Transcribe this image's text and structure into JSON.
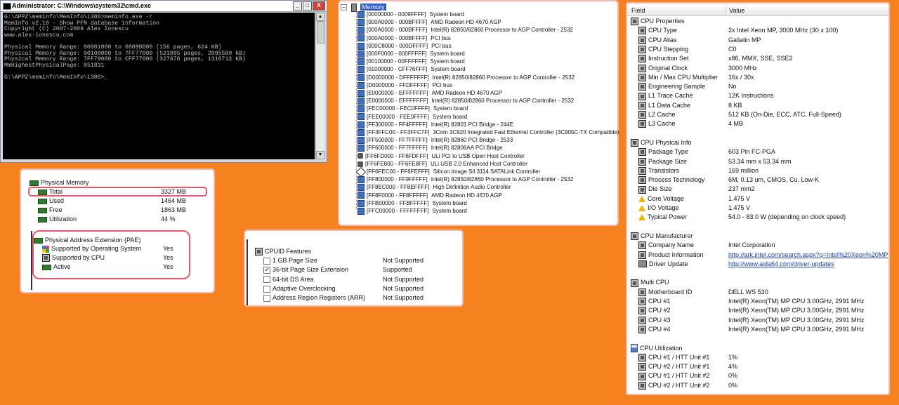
{
  "cmd": {
    "title": "Administrator: C:\\Windows\\system32\\cmd.exe",
    "btn_min": "_",
    "btn_max": "□",
    "btn_close": "X",
    "lines": [
      "G:\\APPZ\\meminfo\\MemInfo\\i386>meminfo.exe -r",
      "MemInfo v2.10 - Show PFN database information",
      "Copyright (C) 2007-2009 Alex Ionescu",
      "www.alex-ionescu.com",
      "",
      "Physical Memory Range: 00001000 to 0009D000 (156 pages, 624 KB)",
      "Physical Memory Range: 00100000 to 7FF77000 (523895 pages, 2095580 KB)",
      "Physical Memory Range: 7FF79000 to CFF77000 (327678 pages, 1310712 KB)",
      "MmHighestPhysicalPage: 851831",
      "",
      "G:\\APPZ\\meminfo\\MemInfo\\i386>_"
    ]
  },
  "memory_panel": {
    "header": "Physical Memory",
    "items": [
      {
        "label": "Total",
        "value": "3327 MB"
      },
      {
        "label": "Used",
        "value": "1464 MB"
      },
      {
        "label": "Free",
        "value": "1863 MB"
      },
      {
        "label": "Utilization",
        "value": "44 %"
      }
    ],
    "pae_header": "Physical Address Extension (PAE)",
    "pae_items": [
      {
        "label": "Supported by Operating System",
        "value": "Yes"
      },
      {
        "label": "Supported by CPU",
        "value": "Yes"
      },
      {
        "label": "Active",
        "value": "Yes"
      }
    ]
  },
  "cpuid_panel": {
    "header": "CPUID Features",
    "items": [
      {
        "label": "1 GB Page Size",
        "value": "Not Supported",
        "checked": false
      },
      {
        "label": "36-bit Page Size Extension",
        "value": "Supported",
        "checked": true
      },
      {
        "label": "64-bit DS Area",
        "value": "Not Supported",
        "checked": false
      },
      {
        "label": "Adaptive Overclocking",
        "value": "Not Supported",
        "checked": false
      },
      {
        "label": "Address Region Registers (ARR)",
        "value": "Not Supported",
        "checked": false
      }
    ]
  },
  "memtree": {
    "root": "Memory",
    "expander": "−",
    "items": [
      {
        "range": "[00000000 - 0009FFFF]",
        "desc": "System board",
        "icon": "monitor"
      },
      {
        "range": "[000A0000 - 000BFFFF]",
        "desc": "AMD Radeon HD 4670 AGP",
        "icon": "monitor"
      },
      {
        "range": "[000A0000 - 000BFFFF]",
        "desc": "Intel(R) 82850/82860 Processor to AGP Controller - 2532",
        "icon": "monitor"
      },
      {
        "range": "[000A0000 - 000BFFFF]",
        "desc": "PCI bus",
        "icon": "monitor"
      },
      {
        "range": "[000C8000 - 000DFFFF]",
        "desc": "PCI bus",
        "icon": "monitor"
      },
      {
        "range": "[000F0000 - 000FFFFF]",
        "desc": "System board",
        "icon": "monitor"
      },
      {
        "range": "[00100000 - 00FFFFFF]",
        "desc": "System board",
        "icon": "monitor"
      },
      {
        "range": "[01000000 - CFF76FFF]",
        "desc": "System board",
        "icon": "monitor"
      },
      {
        "range": "[D0000000 - DFFFFFFF]",
        "desc": "Intel(R) 82850/82860 Processor to AGP Controller - 2532",
        "icon": "monitor"
      },
      {
        "range": "[D0000000 - FFDFFFFF]",
        "desc": "PCI bus",
        "icon": "monitor"
      },
      {
        "range": "[E0000000 - EFFFFFFF]",
        "desc": "AMD Radeon HD 4670 AGP",
        "icon": "monitor"
      },
      {
        "range": "[E0000000 - EFFFFFFF]",
        "desc": "Intel(R) 82850/82860 Processor to AGP Controller - 2532",
        "icon": "monitor"
      },
      {
        "range": "[FEC00000 - FEC0FFFF]",
        "desc": "System board",
        "icon": "monitor"
      },
      {
        "range": "[FEE00000 - FEE0FFFF]",
        "desc": "System board",
        "icon": "monitor"
      },
      {
        "range": "[FF300000 - FF4FFFFF]",
        "desc": "Intel(R) 82801 PCI Bridge - 244E",
        "icon": "monitor"
      },
      {
        "range": "[FF3FFC00 - FF3FFC7F]",
        "desc": "3Com 3C920 Integrated Fast Ethernet Controller (3C905C-TX Compatible)",
        "icon": "monitor"
      },
      {
        "range": "[FF500000 - FF7FFFFF]",
        "desc": "Intel(R) 82860 PCI Bridge - 2533",
        "icon": "monitor"
      },
      {
        "range": "[FF600000 - FF7FFFFF]",
        "desc": "Intel(R) 82806AA PCI Bridge",
        "icon": "monitor"
      },
      {
        "range": "[FF6FD000 - FF6FDFFF]",
        "desc": "ULi PCI to USB Open Host Controller",
        "icon": "usb"
      },
      {
        "range": "[FF6FE800 - FF6FE8FF]",
        "desc": "ULi USB 2.0 Enhanced Host Controller",
        "icon": "usb"
      },
      {
        "range": "[FF6FEC00 - FF6FEFFF]",
        "desc": "Silicon Image SiI 3114 SATALink Controller",
        "icon": "diamond"
      },
      {
        "range": "[FF800000 - FF9FFFFF]",
        "desc": "Intel(R) 82850/82860 Processor to AGP Controller - 2532",
        "icon": "monitor"
      },
      {
        "range": "[FF8EC000 - FF8EFFFF]",
        "desc": "High Definition Audio Controller",
        "icon": "monitor"
      },
      {
        "range": "[FF8F0000 - FF8FFFFF]",
        "desc": "AMD Radeon HD 4670 AGP",
        "icon": "monitor"
      },
      {
        "range": "[FFB00000 - FFBFFFFF]",
        "desc": "System board",
        "icon": "monitor"
      },
      {
        "range": "[FFC00000 - FFFFFFFF]",
        "desc": "System board",
        "icon": "monitor"
      }
    ]
  },
  "cpu_panel": {
    "col_field": "Field",
    "col_value": "Value",
    "sections": [
      {
        "title": "CPU Properties",
        "rows": [
          {
            "label": "CPU Type",
            "value": "2x Intel Xeon MP, 3000 MHz (30 x 100)",
            "icon": "chip"
          },
          {
            "label": "CPU Alias",
            "value": "Gallatin MP",
            "icon": "chip"
          },
          {
            "label": "CPU Stepping",
            "value": "C0",
            "icon": "chip"
          },
          {
            "label": "Instruction Set",
            "value": "x86, MMX, SSE, SSE2",
            "icon": "chip"
          },
          {
            "label": "Original Clock",
            "value": "3000 MHz",
            "icon": "chip"
          },
          {
            "label": "Min / Max CPU Multiplier",
            "value": "16x / 30x",
            "icon": "chip"
          },
          {
            "label": "Engineering Sample",
            "value": "No",
            "icon": "chip"
          },
          {
            "label": "L1 Trace Cache",
            "value": "12K Instructions",
            "icon": "chip"
          },
          {
            "label": "L1 Data Cache",
            "value": "8 KB",
            "icon": "chip"
          },
          {
            "label": "L2 Cache",
            "value": "512 KB  (On-Die, ECC, ATC, Full-Speed)",
            "icon": "chip"
          },
          {
            "label": "L3 Cache",
            "value": "4 MB",
            "icon": "chip"
          }
        ]
      },
      {
        "title": "CPU Physical Info",
        "rows": [
          {
            "label": "Package Type",
            "value": "603 Pin FC-PGA",
            "icon": "chip"
          },
          {
            "label": "Package Size",
            "value": "53.34 mm x 53.34 mm",
            "icon": "chip"
          },
          {
            "label": "Transistors",
            "value": "169 million",
            "icon": "chip"
          },
          {
            "label": "Process Technology",
            "value": "6M, 0.13 um, CMOS, Cu, Low-K",
            "icon": "chip"
          },
          {
            "label": "Die Size",
            "value": "237 mm2",
            "icon": "chip"
          },
          {
            "label": "Core Voltage",
            "value": "1.475 V",
            "icon": "warn"
          },
          {
            "label": "I/O Voltage",
            "value": "1.475 V",
            "icon": "warn"
          },
          {
            "label": "Typical Power",
            "value": "54.0 - 83.0 W  (depending on clock speed)",
            "icon": "warn"
          }
        ]
      },
      {
        "title": "CPU Manufacturer",
        "rows": [
          {
            "label": "Company Name",
            "value": "Intel Corporation",
            "icon": "chip"
          },
          {
            "label": "Product Information",
            "value": "http://ark.intel.com/search.aspx?q=Intel%20Xeon%20MP",
            "icon": "chip",
            "link": true
          },
          {
            "label": "Driver Update",
            "value": "http://www.aida64.com/driver-updates",
            "icon": "disk",
            "link": true
          }
        ]
      },
      {
        "title": "Multi CPU",
        "rows": [
          {
            "label": "Motherboard ID",
            "value": "DELL WS 530",
            "icon": "chip"
          },
          {
            "label": "CPU #1",
            "value": "Intel(R) Xeon(TM) MP CPU 3.00GHz, 2991 MHz",
            "icon": "chip"
          },
          {
            "label": "CPU #2",
            "value": "Intel(R) Xeon(TM) MP CPU 3.00GHz, 2991 MHz",
            "icon": "chip"
          },
          {
            "label": "CPU #3",
            "value": "Intel(R) Xeon(TM) MP CPU 3.00GHz, 2991 MHz",
            "icon": "chip"
          },
          {
            "label": "CPU #4",
            "value": "Intel(R) Xeon(TM) MP CPU 3.00GHz, 2991 MHz",
            "icon": "chip"
          }
        ]
      },
      {
        "title": "CPU Utilization",
        "rows": [
          {
            "label": "CPU #1 / HTT Unit #1",
            "value": "1%",
            "icon": "chip"
          },
          {
            "label": "CPU #2 / HTT Unit #1",
            "value": "4%",
            "icon": "chip"
          },
          {
            "label": "CPU #1 / HTT Unit #2",
            "value": "0%",
            "icon": "chip"
          },
          {
            "label": "CPU #2 / HTT Unit #2",
            "value": "0%",
            "icon": "chip"
          }
        ]
      }
    ]
  }
}
